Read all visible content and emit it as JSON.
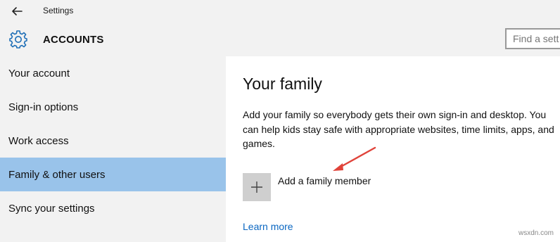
{
  "window": {
    "title": "Settings"
  },
  "header": {
    "title": "ACCOUNTS",
    "search_placeholder": "Find a sett"
  },
  "sidebar": {
    "items": [
      {
        "label": "Your account"
      },
      {
        "label": "Sign-in options"
      },
      {
        "label": "Work access"
      },
      {
        "label": "Family & other users",
        "selected": true
      },
      {
        "label": "Sync your settings"
      }
    ]
  },
  "main": {
    "title": "Your family",
    "description": "Add your family so everybody gets their own sign-in and desktop. You can help kids stay safe with appropriate websites, time limits, apps, and games.",
    "add_label": "Add a family member",
    "learn_more": "Learn more"
  },
  "watermark": "wsxdn.com",
  "colors": {
    "selected_bg": "#99c3ea",
    "accent": "#0b67c2",
    "sidebar_bg": "#f2f2f2",
    "annotation_arrow": "#e0433a"
  },
  "icons": {
    "back": "back-arrow-icon",
    "settings": "gear-icon",
    "add": "plus-icon"
  }
}
